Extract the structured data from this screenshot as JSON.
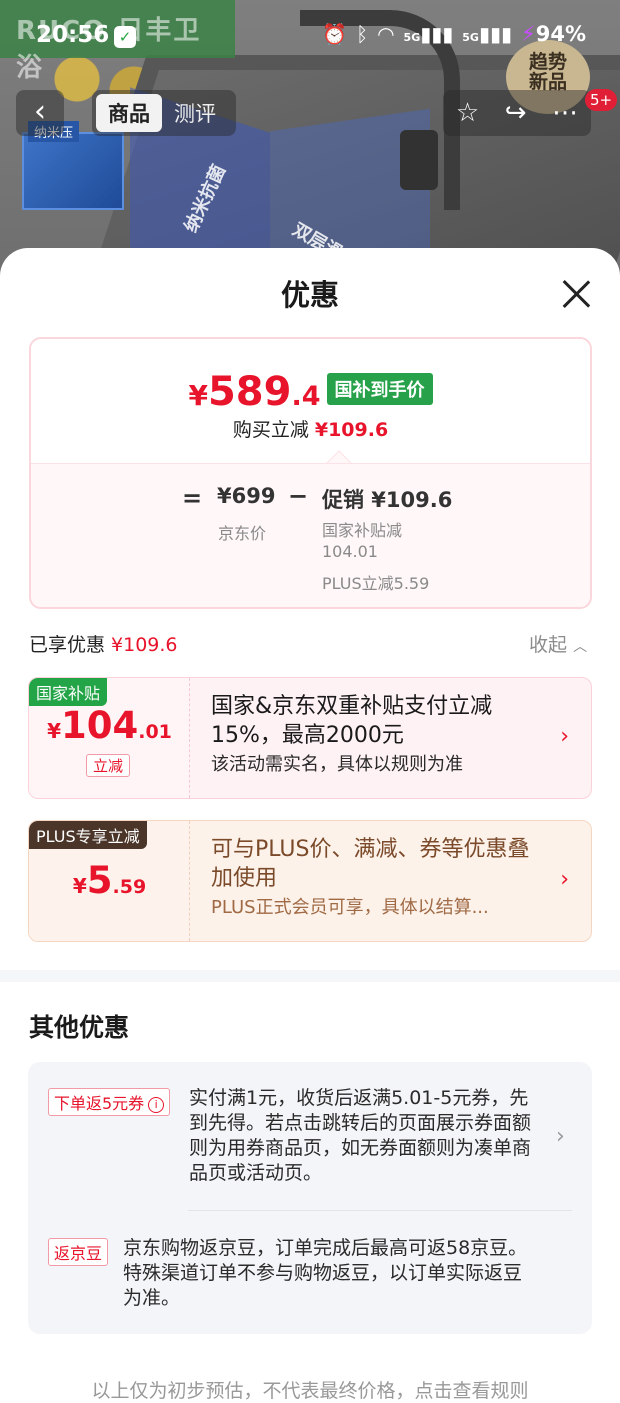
{
  "status_bar": {
    "time": "20:56",
    "net1": "5G",
    "net2": "5G",
    "battery": "94%"
  },
  "background": {
    "brand": "RUCO 日丰卫浴",
    "tile_label": "纳米压",
    "diag1": "纳米抗菌",
    "diag2": "双层滑动",
    "trend_badge_line1": "趋势",
    "trend_badge_line2": "新品",
    "cart_count": "5+"
  },
  "nav": {
    "tabs": [
      "商品",
      "测评"
    ]
  },
  "sheet": {
    "title": "优惠",
    "price_card": {
      "currency": "¥",
      "price_int": "589",
      "price_dec": ".4",
      "subsidy_tag": "国补到手价",
      "buy_reduce_label": "购买立减",
      "buy_reduce_value": "¥109.6",
      "eq": "=",
      "jd_price": "¥699",
      "jd_label": "京东价",
      "minus": "−",
      "promo": "促销 ¥109.6",
      "promo_detail1_line1": "国家补贴减",
      "promo_detail1_line2": "104.01",
      "promo_detail2": "PLUS立减5.59"
    },
    "enjoyed_label": "已享优惠",
    "enjoyed_value": "¥109.6",
    "collapse_label": "收起",
    "deals": [
      {
        "tag": "国家补贴",
        "currency": "¥",
        "int": "104",
        "dec": ".01",
        "reduce_tag": "立减",
        "line1": "国家&京东双重补贴支付立减15%，最高2000元",
        "line2": "该活动需实名，具体以规则为准"
      },
      {
        "tag": "PLUS专享立减",
        "currency": "¥",
        "int": "5",
        "dec": ".59",
        "line1": "可与PLUS价、满减、券等优惠叠加使用",
        "line2": "PLUS正式会员可享，具体以结算..."
      }
    ],
    "other_title": "其他优惠",
    "other_offers": [
      {
        "tag": "下单返5元券",
        "text": "实付满1元，收货后返满5.01-5元券，先到先得。若点击跳转后的页面展示券面额则为用券商品页，如无券面额则为凑单商品页或活动页。"
      },
      {
        "tag": "返京豆",
        "text": "京东购物返京豆，订单完成后最高可返58京豆。特殊渠道订单不参与购物返豆，以订单实际返豆为准。"
      }
    ],
    "footer_note": "以上仅为初步预估，不代表最终价格，点击查看规则"
  },
  "colors": {
    "price_red": "#e8142b",
    "subsidy_green": "#27a24a",
    "plus_brown": "#4a3528"
  }
}
